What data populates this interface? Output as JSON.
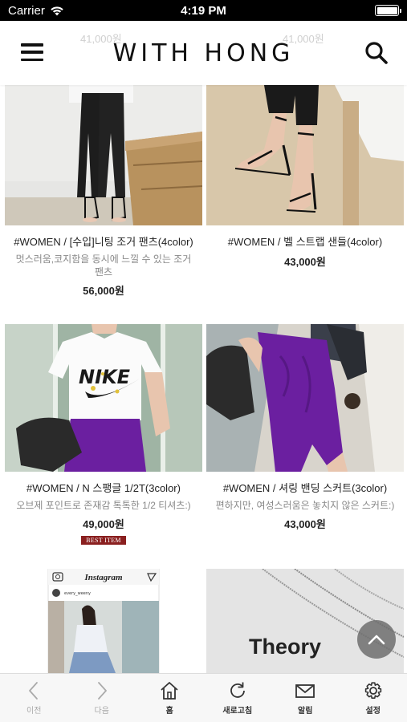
{
  "status_bar": {
    "carrier": "Carrier",
    "time": "4:19 PM"
  },
  "header": {
    "logo": "WITH HONG",
    "ghost_price_left": "41,000원",
    "ghost_price_right": "41,000원"
  },
  "products": [
    {
      "title": "#WOMEN / [수입]니팅 조거 팬츠(4color)",
      "description": "멋스러움,코지함을 동시에 느낄 수 있는 조거 팬츠",
      "price": "56,000원"
    },
    {
      "title": "#WOMEN / 벨 스트랩 샌들(4color)",
      "description": "",
      "price": "43,000원"
    },
    {
      "title": "#WOMEN / N 스팽글 1/2T(3color)",
      "description": "오브제 포인트로 존재감 톡톡한 1/2 티셔츠:)",
      "price": "49,000원",
      "badge": "BEST ITEM"
    },
    {
      "title": "#WOMEN / 셔링 밴딩 스커트(3color)",
      "description": "편하지만, 여성스러움은 놓치지 않은 스커트:)",
      "price": "43,000원"
    },
    {
      "title": "",
      "description": "",
      "price": "",
      "image_text": "Instagram",
      "image_subtext": "every_weeny"
    },
    {
      "title": "",
      "description": "",
      "price": "",
      "image_text": "Theory"
    }
  ],
  "tshirt_print": "NIKE",
  "toolbar": [
    {
      "label": "이전",
      "icon": "chevron-left-icon",
      "enabled": false
    },
    {
      "label": "다음",
      "icon": "chevron-right-icon",
      "enabled": false
    },
    {
      "label": "홈",
      "icon": "home-icon",
      "enabled": true
    },
    {
      "label": "새로고침",
      "icon": "refresh-icon",
      "enabled": true
    },
    {
      "label": "알림",
      "icon": "mail-icon",
      "enabled": true
    },
    {
      "label": "설정",
      "icon": "gear-icon",
      "enabled": true
    }
  ],
  "colors": {
    "badge": "#8a1f1f",
    "skirt": "#6b1fa0",
    "toolbar_bg": "#f7f7f7"
  }
}
